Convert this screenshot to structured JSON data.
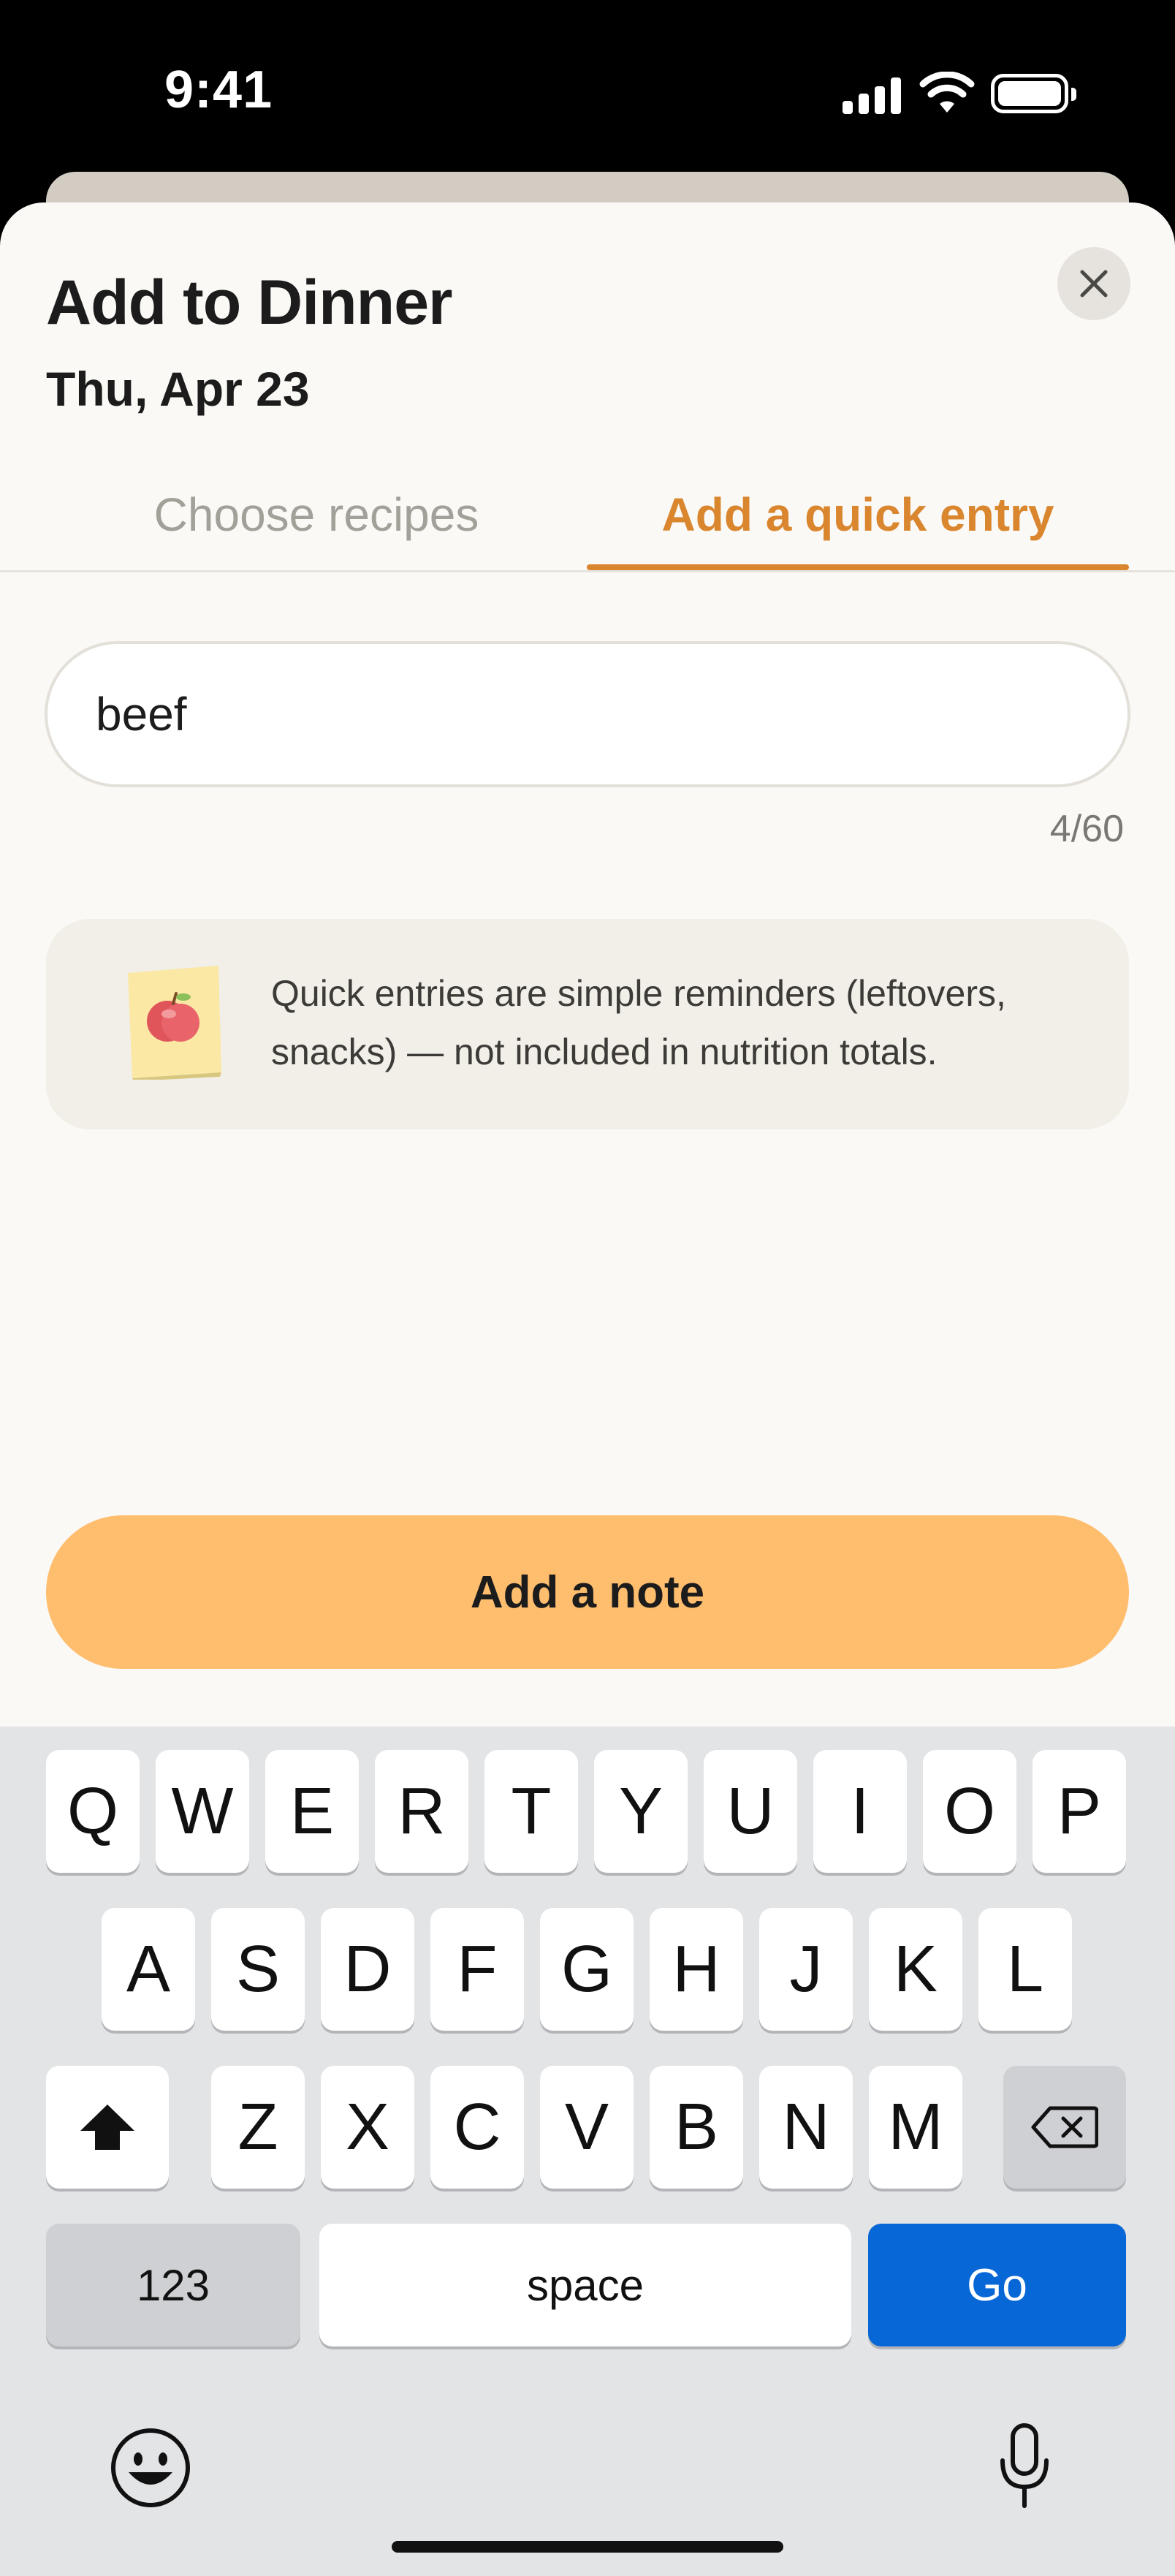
{
  "status_bar": {
    "time": "9:41"
  },
  "sheet": {
    "title": "Add to Dinner",
    "date": "Thu, Apr 23",
    "tabs": [
      {
        "label": "Choose recipes",
        "active": false
      },
      {
        "label": "Add a quick entry",
        "active": true
      }
    ],
    "entry": {
      "value": "beef",
      "char_count": "4/60"
    },
    "info": {
      "text": "Quick entries are simple reminders (leftovers, snacks) — not  included in nutrition totals."
    },
    "primary_button": "Add a note"
  },
  "keyboard": {
    "row1": [
      "Q",
      "W",
      "E",
      "R",
      "T",
      "Y",
      "U",
      "I",
      "O",
      "P"
    ],
    "row2": [
      "A",
      "S",
      "D",
      "F",
      "G",
      "H",
      "J",
      "K",
      "L"
    ],
    "row3": [
      "Z",
      "X",
      "C",
      "V",
      "B",
      "N",
      "M"
    ],
    "numbers_label": "123",
    "space_label": "space",
    "go_label": "Go"
  },
  "colors": {
    "accent": "#d9862f",
    "primary_button": "#ffbd6e",
    "go_key": "#0767d6",
    "sheet_bg": "#fbf9f5"
  }
}
